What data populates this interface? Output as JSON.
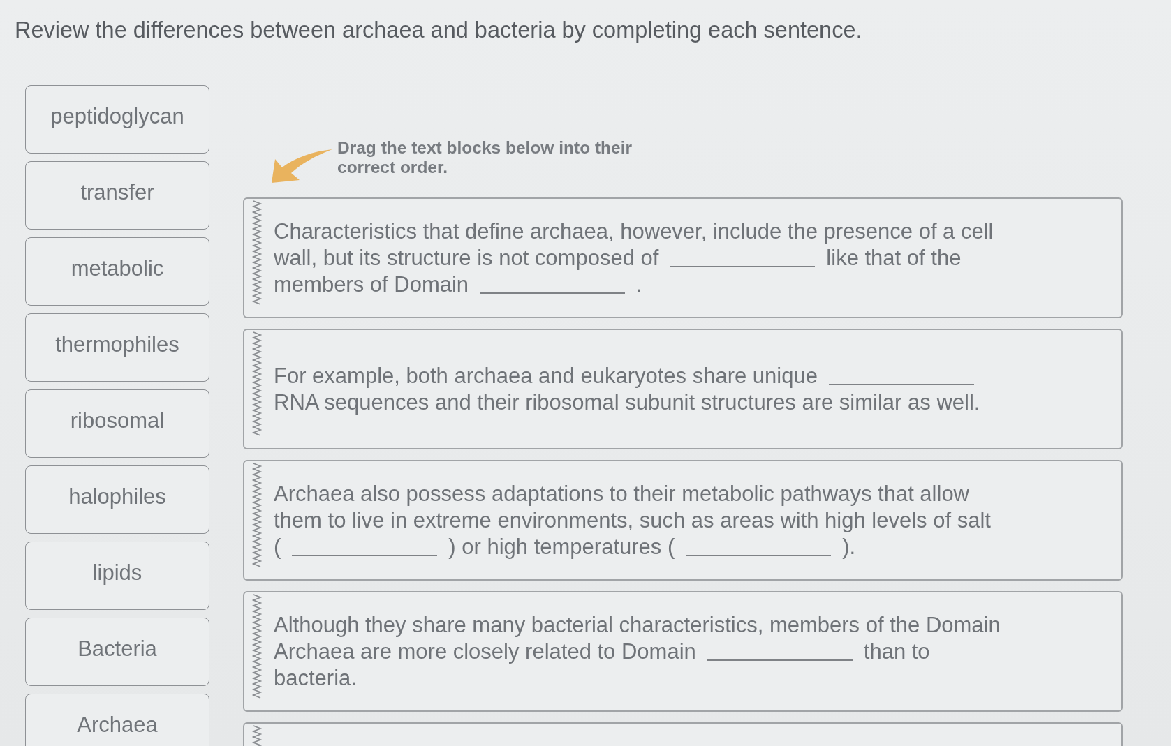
{
  "title": "Review the differences between archaea and bacteria by completing each sentence.",
  "word_bank": [
    "peptidoglycan",
    "transfer",
    "metabolic",
    "thermophiles",
    "ribosomal",
    "halophiles",
    "lipids",
    "Bacteria",
    "Archaea"
  ],
  "instruction": "Drag the text blocks below into their correct order.",
  "sentence_blocks": [
    {
      "lines": [
        [
          {
            "kind": "text",
            "text": "Characteristics that define archaea, however, include the presence of a cell"
          }
        ],
        [
          {
            "kind": "text",
            "text": "wall, but its structure is not composed of"
          },
          {
            "kind": "blank"
          },
          {
            "kind": "text",
            "text": "like that of the"
          }
        ],
        [
          {
            "kind": "text",
            "text": "members of Domain"
          },
          {
            "kind": "blank"
          },
          {
            "kind": "text",
            "text": "."
          }
        ]
      ]
    },
    {
      "lines": [
        [
          {
            "kind": "text",
            "text": "For example, both archaea and eukaryotes share unique"
          },
          {
            "kind": "blank"
          }
        ],
        [
          {
            "kind": "text",
            "text": "RNA sequences and their ribosomal subunit structures are similar as well."
          }
        ]
      ]
    },
    {
      "lines": [
        [
          {
            "kind": "text",
            "text": "Archaea also possess adaptations to their metabolic pathways that allow"
          }
        ],
        [
          {
            "kind": "text",
            "text": "them to live in extreme environments, such as areas with high levels of salt"
          }
        ],
        [
          {
            "kind": "text",
            "text": "("
          },
          {
            "kind": "blank"
          },
          {
            "kind": "text",
            "text": ") or high temperatures ("
          },
          {
            "kind": "blank"
          },
          {
            "kind": "text",
            "text": ")."
          }
        ]
      ]
    },
    {
      "lines": [
        [
          {
            "kind": "text",
            "text": "Although they share many bacterial characteristics, members of the Domain"
          }
        ],
        [
          {
            "kind": "text",
            "text": "Archaea are more closely related to Domain"
          },
          {
            "kind": "blank"
          },
          {
            "kind": "text",
            "text": "than to"
          }
        ],
        [
          {
            "kind": "text",
            "text": "bacteria."
          }
        ]
      ]
    }
  ],
  "partially_visible_block": true
}
